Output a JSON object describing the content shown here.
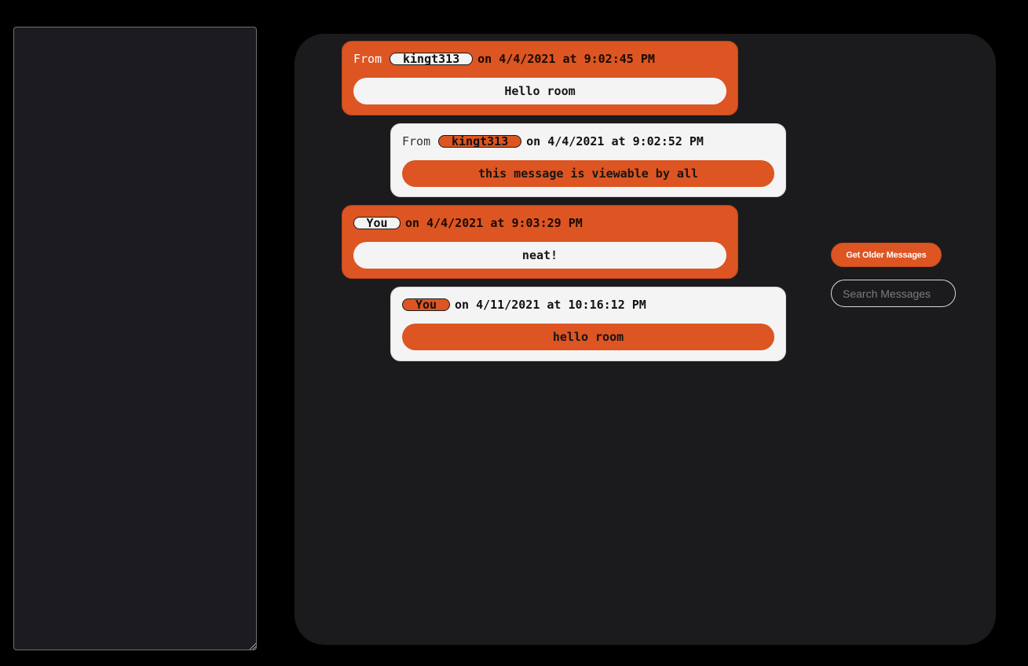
{
  "side_panel": {
    "value": ""
  },
  "messages": [
    {
      "from_label": "From",
      "name": "kingt313",
      "timestamp": "on 4/4/2021 at 9:02:45 PM",
      "body": "Hello room"
    },
    {
      "from_label": "From",
      "name": "kingt313",
      "timestamp": "on 4/4/2021 at 9:02:52 PM",
      "body": "this message is viewable by all"
    },
    {
      "from_label": "",
      "name": "You",
      "timestamp": "on 4/4/2021 at 9:03:29 PM",
      "body": "neat!"
    },
    {
      "from_label": "",
      "name": "You",
      "timestamp": "on 4/11/2021 at 10:16:12 PM",
      "body": "hello room"
    }
  ],
  "controls": {
    "older_label": "Get Older Messages",
    "search_placeholder": "Search Messages",
    "search_value": ""
  },
  "colors": {
    "accent": "#dd5522",
    "bubble_light": "#f4f4f4",
    "panel": "#1b1b1d",
    "background": "#000000"
  }
}
